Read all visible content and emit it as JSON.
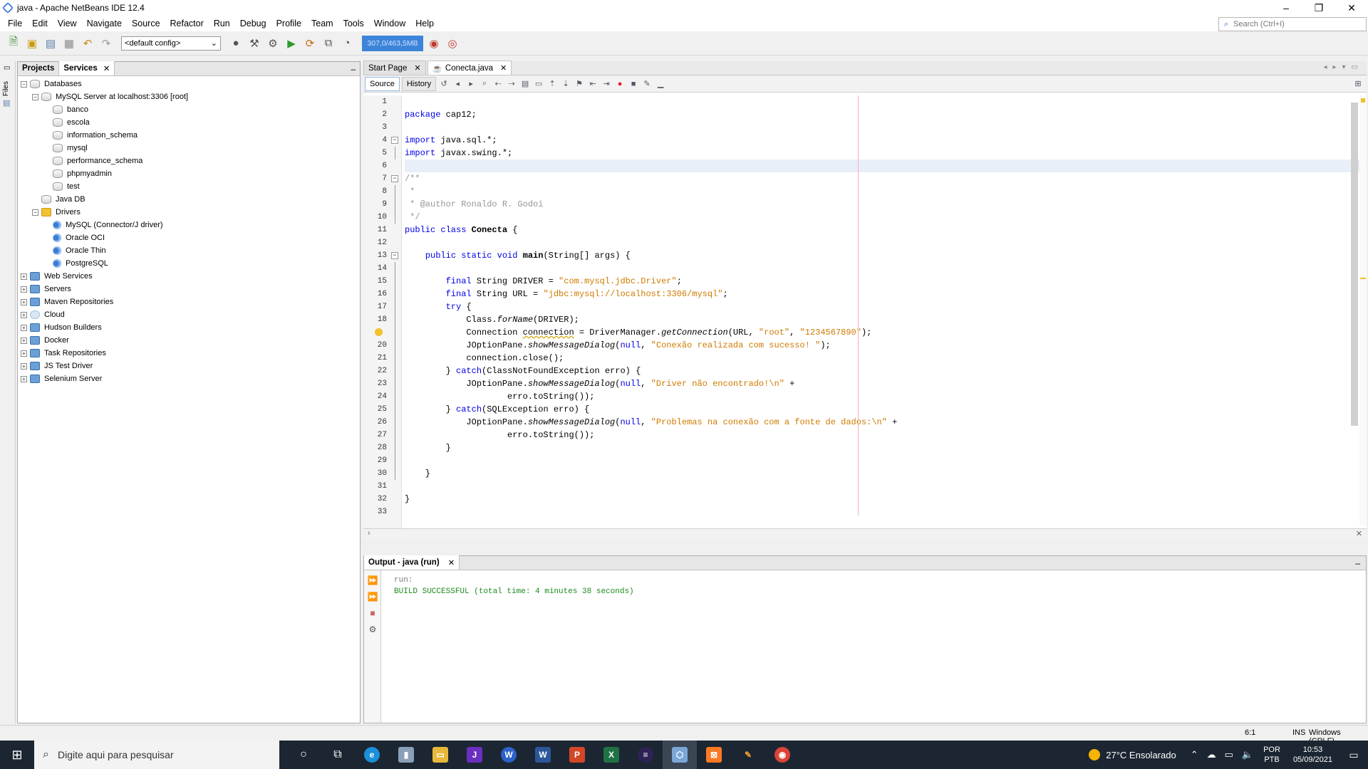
{
  "window": {
    "title": "java - Apache NetBeans IDE 12.4",
    "controls": [
      "–",
      "❐",
      "✕"
    ]
  },
  "menu": [
    "File",
    "Edit",
    "View",
    "Navigate",
    "Source",
    "Refactor",
    "Run",
    "Debug",
    "Profile",
    "Team",
    "Tools",
    "Window",
    "Help"
  ],
  "quick_search": {
    "placeholder": "Search (Ctrl+I)"
  },
  "toolbar": {
    "config": "<default config>",
    "memory": "307,0/463,5MB"
  },
  "left_strip": {
    "label": "Files"
  },
  "left_panel": {
    "tabs": [
      "Projects",
      "Services"
    ],
    "services_close": "✕",
    "minimize": "–",
    "tree": [
      {
        "label": "Databases",
        "depth": 0,
        "toggle": "−",
        "icon": "db"
      },
      {
        "label": "MySQL Server at localhost:3306 [root]",
        "depth": 1,
        "toggle": "−",
        "icon": "db"
      },
      {
        "label": "banco",
        "depth": 2,
        "icon": "db"
      },
      {
        "label": "escola",
        "depth": 2,
        "icon": "db"
      },
      {
        "label": "information_schema",
        "depth": 2,
        "icon": "db"
      },
      {
        "label": "mysql",
        "depth": 2,
        "icon": "db"
      },
      {
        "label": "performance_schema",
        "depth": 2,
        "icon": "db"
      },
      {
        "label": "phpmyadmin",
        "depth": 2,
        "icon": "db"
      },
      {
        "label": "test",
        "depth": 2,
        "icon": "db"
      },
      {
        "label": "Java DB",
        "depth": 1,
        "icon": "db"
      },
      {
        "label": "Drivers",
        "depth": 1,
        "toggle": "−",
        "icon": "folder"
      },
      {
        "label": "MySQL (Connector/J driver)",
        "depth": 2,
        "icon": "driver"
      },
      {
        "label": "Oracle OCI",
        "depth": 2,
        "icon": "driver"
      },
      {
        "label": "Oracle Thin",
        "depth": 2,
        "icon": "driver"
      },
      {
        "label": "PostgreSQL",
        "depth": 2,
        "icon": "driver"
      },
      {
        "label": "Web Services",
        "depth": 0,
        "toggle": "+",
        "icon": "svc"
      },
      {
        "label": "Servers",
        "depth": 0,
        "toggle": "+",
        "icon": "svc"
      },
      {
        "label": "Maven Repositories",
        "depth": 0,
        "toggle": "+",
        "icon": "svc"
      },
      {
        "label": "Cloud",
        "depth": 0,
        "toggle": "+",
        "icon": "cloud"
      },
      {
        "label": "Hudson Builders",
        "depth": 0,
        "toggle": "+",
        "icon": "svc"
      },
      {
        "label": "Docker",
        "depth": 0,
        "toggle": "+",
        "icon": "svc"
      },
      {
        "label": "Task Repositories",
        "depth": 0,
        "toggle": "+",
        "icon": "svc"
      },
      {
        "label": "JS Test Driver",
        "depth": 0,
        "toggle": "+",
        "icon": "svc"
      },
      {
        "label": "Selenium Server",
        "depth": 0,
        "toggle": "+",
        "icon": "svc"
      }
    ]
  },
  "editor": {
    "tabs": [
      {
        "label": "Start Page",
        "close": "✕"
      },
      {
        "label": "Conecta.java",
        "close": "✕"
      }
    ],
    "views": [
      "Source",
      "History"
    ],
    "lines": [
      {
        "n": "1",
        "segs": []
      },
      {
        "n": "2",
        "segs": [
          {
            "t": "package",
            "c": "kw"
          },
          {
            "t": " cap12;"
          }
        ]
      },
      {
        "n": "3",
        "segs": []
      },
      {
        "n": "4",
        "fold": "−",
        "segs": [
          {
            "t": "import",
            "c": "kw"
          },
          {
            "t": " java.sql.*;"
          }
        ]
      },
      {
        "n": "5",
        "foldline": true,
        "segs": [
          {
            "t": "import",
            "c": "kw"
          },
          {
            "t": " javax.swing.*;"
          }
        ]
      },
      {
        "n": "6",
        "hl": true,
        "segs": []
      },
      {
        "n": "7",
        "fold": "−",
        "segs": [
          {
            "t": "/**",
            "c": "cmt"
          }
        ]
      },
      {
        "n": "8",
        "foldline": true,
        "segs": [
          {
            "t": " *",
            "c": "cmt"
          }
        ]
      },
      {
        "n": "9",
        "foldline": true,
        "segs": [
          {
            "t": " * @author Ronaldo R. Godoi",
            "c": "cmt"
          }
        ]
      },
      {
        "n": "10",
        "foldline": true,
        "segs": [
          {
            "t": " */",
            "c": "cmt"
          }
        ]
      },
      {
        "n": "11",
        "segs": [
          {
            "t": "public class",
            "c": "kw"
          },
          {
            "t": " "
          },
          {
            "t": "Conecta",
            "c": "b"
          },
          {
            "t": " {"
          }
        ]
      },
      {
        "n": "12",
        "segs": []
      },
      {
        "n": "13",
        "fold": "−",
        "segs": [
          {
            "t": "    "
          },
          {
            "t": "public static void",
            "c": "kw"
          },
          {
            "t": " "
          },
          {
            "t": "main",
            "c": "b"
          },
          {
            "t": "(String[] args) {"
          }
        ]
      },
      {
        "n": "14",
        "foldline": true,
        "segs": []
      },
      {
        "n": "15",
        "foldline": true,
        "segs": [
          {
            "t": "        "
          },
          {
            "t": "final",
            "c": "kw"
          },
          {
            "t": " String DRIVER = "
          },
          {
            "t": "\"com.mysql.jdbc.Driver\"",
            "c": "str"
          },
          {
            "t": ";"
          }
        ]
      },
      {
        "n": "16",
        "foldline": true,
        "segs": [
          {
            "t": "        "
          },
          {
            "t": "final",
            "c": "kw"
          },
          {
            "t": " String URL = "
          },
          {
            "t": "\"jdbc:mysql://localhost:3306/mysql\"",
            "c": "str"
          },
          {
            "t": ";"
          }
        ]
      },
      {
        "n": "17",
        "foldline": true,
        "segs": [
          {
            "t": "        "
          },
          {
            "t": "try",
            "c": "kw"
          },
          {
            "t": " {"
          }
        ]
      },
      {
        "n": "18",
        "foldline": true,
        "segs": [
          {
            "t": "            Class."
          },
          {
            "t": "forName",
            "c": "it"
          },
          {
            "t": "(DRIVER);"
          }
        ]
      },
      {
        "n": "",
        "warn": true,
        "foldline": true,
        "segs": [
          {
            "t": "            Connection "
          },
          {
            "t": "connection",
            "c": "uline"
          },
          {
            "t": " = DriverManager."
          },
          {
            "t": "getConnection",
            "c": "it"
          },
          {
            "t": "(URL, "
          },
          {
            "t": "\"root\"",
            "c": "str"
          },
          {
            "t": ", "
          },
          {
            "t": "\"1234567890\"",
            "c": "str"
          },
          {
            "t": ");"
          }
        ]
      },
      {
        "n": "20",
        "foldline": true,
        "segs": [
          {
            "t": "            JOptionPane."
          },
          {
            "t": "showMessageDialog",
            "c": "it"
          },
          {
            "t": "("
          },
          {
            "t": "null",
            "c": "kw"
          },
          {
            "t": ", "
          },
          {
            "t": "\"Conexão realizada com sucesso! \"",
            "c": "str"
          },
          {
            "t": ");"
          }
        ]
      },
      {
        "n": "21",
        "foldline": true,
        "segs": [
          {
            "t": "            connection.close();"
          }
        ]
      },
      {
        "n": "22",
        "foldline": true,
        "segs": [
          {
            "t": "        } "
          },
          {
            "t": "catch",
            "c": "kw"
          },
          {
            "t": "(ClassNotFoundException erro) {"
          }
        ]
      },
      {
        "n": "23",
        "foldline": true,
        "segs": [
          {
            "t": "            JOptionPane."
          },
          {
            "t": "showMessageDialog",
            "c": "it"
          },
          {
            "t": "("
          },
          {
            "t": "null",
            "c": "kw"
          },
          {
            "t": ", "
          },
          {
            "t": "\"Driver não encontrado!\\n\"",
            "c": "str"
          },
          {
            "t": " +"
          }
        ]
      },
      {
        "n": "24",
        "foldline": true,
        "segs": [
          {
            "t": "                    erro.toString());"
          }
        ]
      },
      {
        "n": "25",
        "foldline": true,
        "segs": [
          {
            "t": "        } "
          },
          {
            "t": "catch",
            "c": "kw"
          },
          {
            "t": "(SQLException erro) {"
          }
        ]
      },
      {
        "n": "26",
        "foldline": true,
        "segs": [
          {
            "t": "            JOptionPane."
          },
          {
            "t": "showMessageDialog",
            "c": "it"
          },
          {
            "t": "("
          },
          {
            "t": "null",
            "c": "kw"
          },
          {
            "t": ", "
          },
          {
            "t": "\"Problemas na conexão com a fonte de dados:\\n\"",
            "c": "str"
          },
          {
            "t": " +"
          }
        ]
      },
      {
        "n": "27",
        "foldline": true,
        "segs": [
          {
            "t": "                    erro.toString());"
          }
        ]
      },
      {
        "n": "28",
        "foldline": true,
        "segs": [
          {
            "t": "        }"
          }
        ]
      },
      {
        "n": "29",
        "foldline": true,
        "segs": []
      },
      {
        "n": "30",
        "foldline": true,
        "segs": [
          {
            "t": "    }"
          }
        ]
      },
      {
        "n": "31",
        "segs": []
      },
      {
        "n": "32",
        "segs": [
          {
            "t": "}"
          }
        ]
      },
      {
        "n": "33",
        "segs": []
      }
    ]
  },
  "output": {
    "tab": "Output - java (run)",
    "close": "✕",
    "minimize": "–",
    "lines": [
      {
        "text": "run:",
        "cls": "run"
      },
      {
        "text": "BUILD SUCCESSFUL (total time: 4 minutes 38 seconds)",
        "cls": "ok"
      }
    ]
  },
  "statusbar": {
    "caret": "6:1",
    "mode": "INS",
    "line_endings": "Windows (CRLF)"
  },
  "taskbar": {
    "search_placeholder": "Digite aqui para pesquisar",
    "weather": "27°C  Ensolarado",
    "lang_1": "POR",
    "lang_2": "PTB",
    "time": "10:53",
    "date": "05/09/2021"
  }
}
